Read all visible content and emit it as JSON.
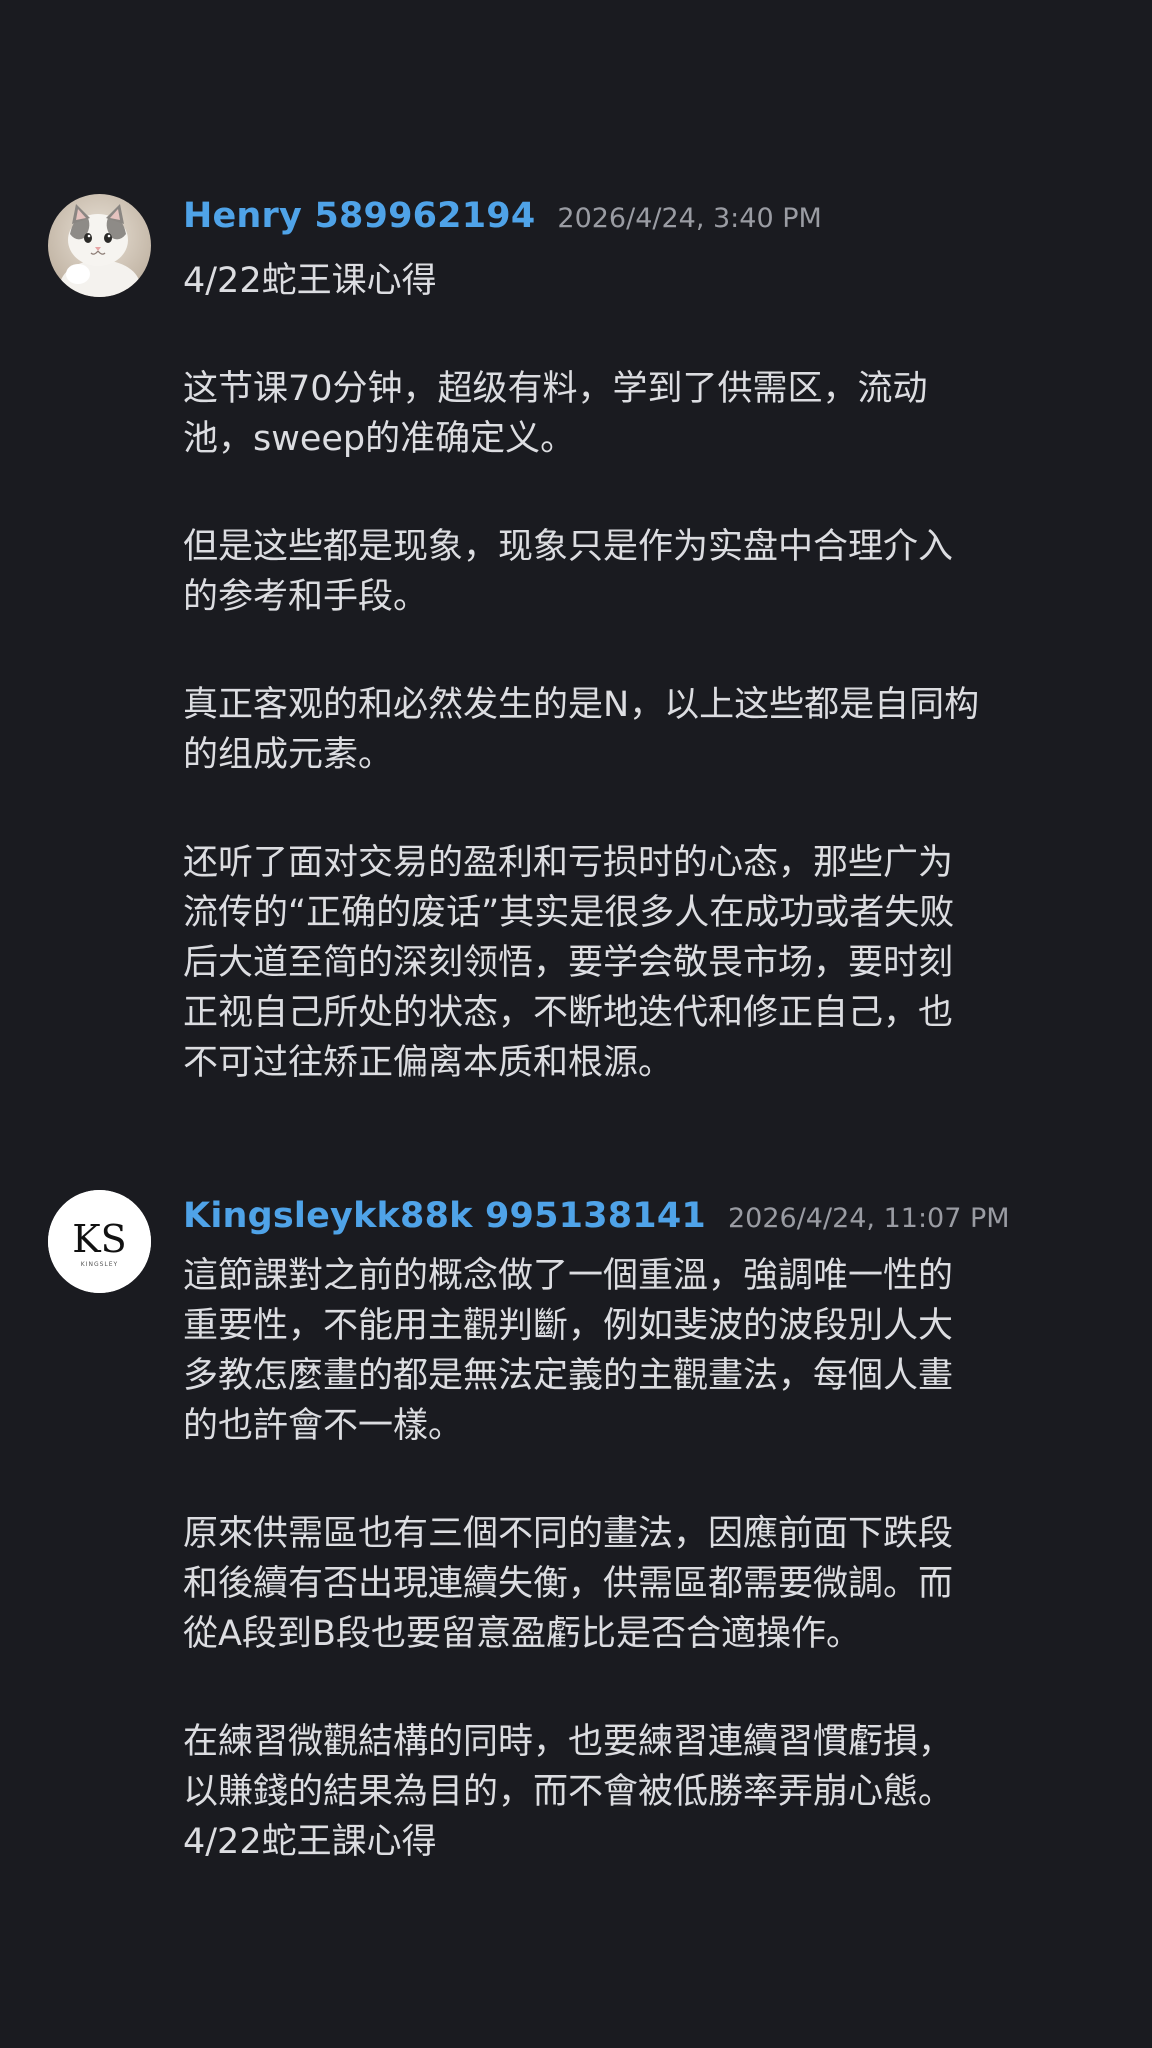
{
  "messages": [
    {
      "author": "Henry 589962194",
      "timestamp": "2026/4/24, 3:40 PM",
      "paragraphs": [
        [
          "4/22蛇王课心得"
        ],
        [
          "这节课70分钟，超级有料，学到了供需区，流动",
          "池，sweep的准确定义。"
        ],
        [
          "但是这些都是现象，现象只是作为实盘中合理介入",
          "的参考和手段。"
        ],
        [
          "真正客观的和必然发生的是N，以上这些都是自同构",
          "的组成元素。"
        ],
        [
          "还听了面对交易的盈利和亏损时的心态，那些广为",
          "流传的“正确的废话”其实是很多人在成功或者失败",
          "后大道至简的深刻领悟，要学会敬畏市场，要时刻",
          "正视自己所处的状态，不断地迭代和修正自己，也",
          "不可过往矫正偏离本质和根源。"
        ]
      ]
    },
    {
      "author": "Kingsleykk88k 995138141",
      "timestamp": "2026/4/24, 11:07 PM",
      "avatar_text": "KS",
      "avatar_subtext": "KINGSLEY",
      "paragraphs": [
        [
          "這節課對之前的概念做了一個重溫，強調唯一性的",
          "重要性，不能用主觀判斷，例如斐波的波段別人大",
          "多教怎麼畫的都是無法定義的主觀畫法，每個人畫",
          "的也許會不一樣。"
        ],
        [
          "原來供需區也有三個不同的畫法，因應前面下跌段",
          "和後續有否出現連續失衡，供需區都需要微調。而",
          "從A段到B段也要留意盈虧比是否合適操作。"
        ],
        [
          "在練習微觀結構的同時，也要練習連續習慣虧損，",
          "以賺錢的結果為目的，而不會被低勝率弄崩心態。",
          "4/22蛇王課心得"
        ]
      ]
    }
  ],
  "colors": {
    "background": "#1a1b20",
    "username": "#4fa3e8",
    "timestamp": "#9a9ca3",
    "text": "#dcdde1"
  }
}
